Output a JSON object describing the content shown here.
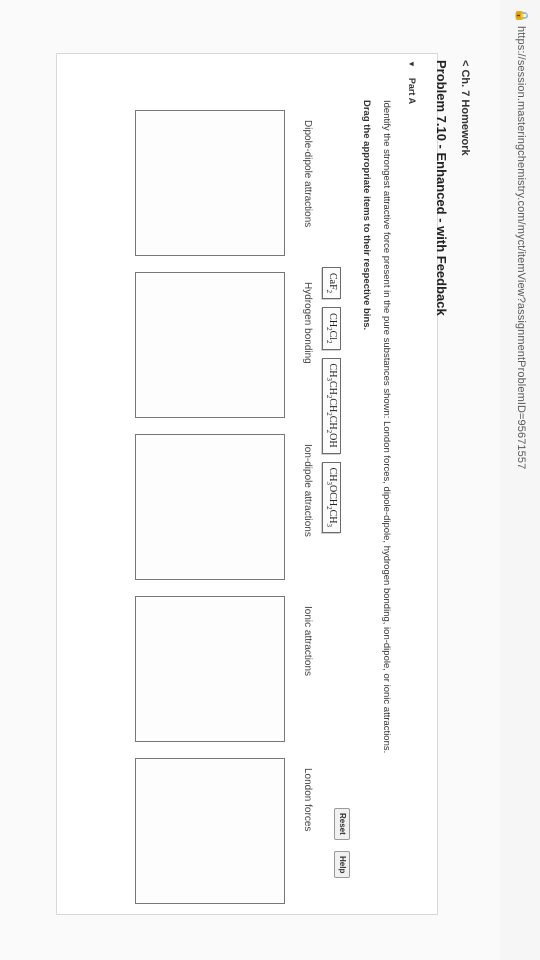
{
  "browser": {
    "url": "https://session.masteringchemistry.com/myct/itemView?assignmentProblemID=95671557"
  },
  "header": {
    "back_link": "< Ch. 7 Homework",
    "problem_title": "Problem 7.10 - Enhanced - with Feedback",
    "part_label": "Part A"
  },
  "question": {
    "instructions": "Identify the strongest attractive force present in the pure substances shown: London forces, dipole-dipole, hydrogen bonding, ion-dipole, or ionic attractions.",
    "drag_note": "Drag the appropriate items to their respective bins."
  },
  "tokens": [
    {
      "label": "CaF2"
    },
    {
      "label": "CH2Cl2"
    },
    {
      "label": "CH3CH2CH2CH2OH"
    },
    {
      "label": "CH3OCH2CH3"
    }
  ],
  "controls": {
    "reset_label": "Reset",
    "help_label": "Help"
  },
  "bins": [
    {
      "label": "Dipole-dipole attractions"
    },
    {
      "label": "Hydrogen bonding"
    },
    {
      "label": "Ion-dipole attractions"
    },
    {
      "label": "Ionic attractions"
    },
    {
      "label": "London forces"
    }
  ]
}
